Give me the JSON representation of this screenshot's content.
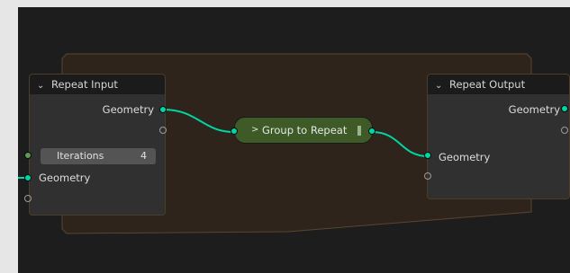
{
  "repeat_input": {
    "title": "Repeat Input",
    "output_geometry": "Geometry",
    "iterations_label": "Iterations",
    "iterations_value": "4",
    "input_geometry": "Geometry"
  },
  "group_node": {
    "label": "Group to Repeat"
  },
  "repeat_output": {
    "title": "Repeat Output",
    "output_geometry": "Geometry",
    "input_geometry": "Geometry"
  },
  "colors": {
    "geometry_socket": "#00d6a3",
    "integer_socket": "#5d9b55",
    "zone_fill": "#2e241c",
    "group_node": "#3d5a27"
  },
  "icons": {
    "collapse": "chevron-down-icon",
    "group": "chevron-right-icon"
  }
}
